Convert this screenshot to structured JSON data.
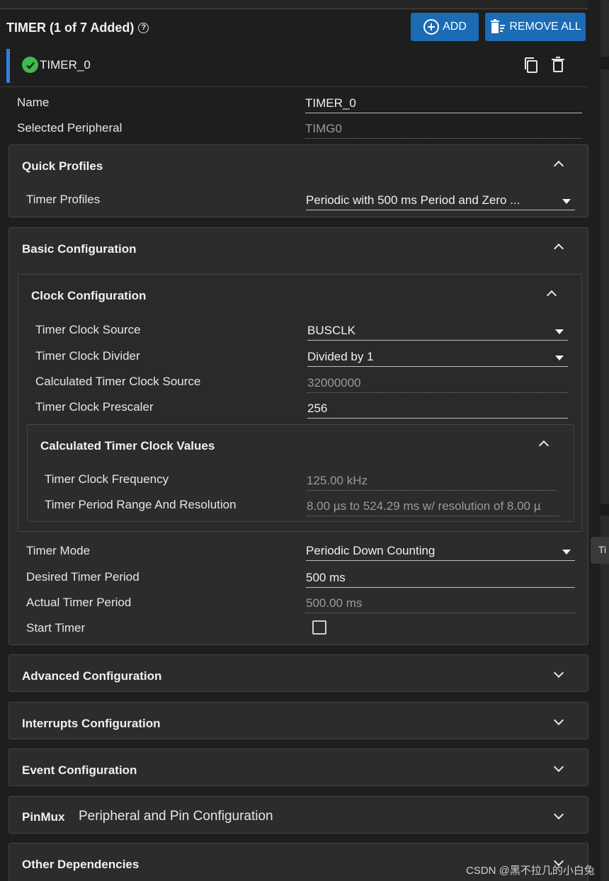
{
  "header": {
    "title": "TIMER (1 of 7 Added)",
    "add_label": "ADD",
    "remove_all_label": "REMOVE ALL"
  },
  "instance": {
    "name": "TIMER_0"
  },
  "fields": {
    "name_label": "Name",
    "name_value": "TIMER_0",
    "peripheral_label": "Selected Peripheral",
    "peripheral_value": "TIMG0"
  },
  "quick_profiles": {
    "title": "Quick Profiles",
    "timer_profiles_label": "Timer Profiles",
    "timer_profiles_value": "Periodic with 500 ms Period and Zero ..."
  },
  "basic": {
    "title": "Basic Configuration",
    "clock": {
      "title": "Clock Configuration",
      "source_label": "Timer Clock Source",
      "source_value": "BUSCLK",
      "divider_label": "Timer Clock Divider",
      "divider_value": "Divided by 1",
      "calc_source_label": "Calculated Timer Clock Source",
      "calc_source_value": "32000000",
      "prescaler_label": "Timer Clock Prescaler",
      "prescaler_value": "256",
      "calc_values": {
        "title": "Calculated Timer Clock Values",
        "freq_label": "Timer Clock Frequency",
        "freq_value": "125.00 kHz",
        "range_label": "Timer Period Range And Resolution",
        "range_value": "8.00 µs to 524.29 ms w/ resolution of 8.00 µ"
      }
    },
    "mode_label": "Timer Mode",
    "mode_value": "Periodic Down Counting",
    "desired_label": "Desired Timer Period",
    "desired_value": "500 ms",
    "actual_label": "Actual Timer Period",
    "actual_value": "500.00 ms",
    "start_label": "Start Timer"
  },
  "sections": {
    "advanced": "Advanced Configuration",
    "interrupts": "Interrupts Configuration",
    "event": "Event Configuration",
    "pinmux": "PinMux",
    "pinmux_sub": "Peripheral and Pin Configuration",
    "other": "Other Dependencies"
  },
  "tooltip": "Ti",
  "watermark": "CSDN @黑不拉几的小白兔",
  "colors": {
    "accent": "#1b6bb5",
    "instance_bar": "#2f80e0",
    "check": "#3fb950",
    "background": "#1e1e1e",
    "panel": "#2c2c2c"
  }
}
